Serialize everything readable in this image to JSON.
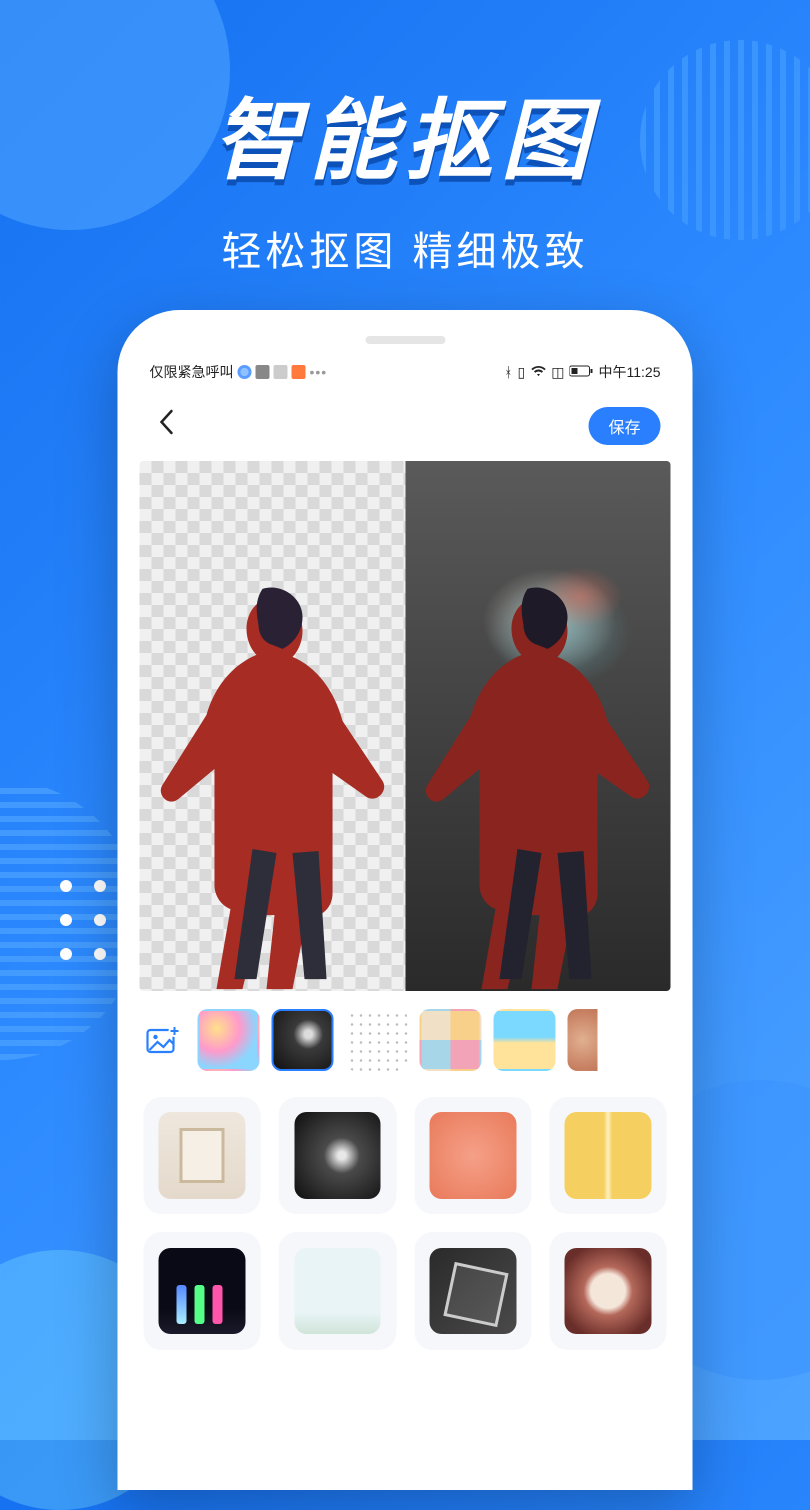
{
  "hero": {
    "title": "智能抠图",
    "subtitle": "轻松抠图 精细极致"
  },
  "statusbar": {
    "left_text": "仅限紧急呼叫",
    "right_time": "中午11:25"
  },
  "navbar": {
    "save_label": "保存"
  },
  "thumbstrip": {
    "add_icon": "add-image-icon",
    "items": [
      "pattern-1",
      "moon-surface",
      "speckle",
      "pastel-grid",
      "beach",
      "mosaic"
    ],
    "selected_index": 1
  },
  "grid": {
    "items": [
      "frame",
      "astronaut",
      "coral-texture",
      "yellow-hall",
      "neon-bottles",
      "minimal-sky",
      "glass-cube",
      "brown-ring"
    ]
  }
}
